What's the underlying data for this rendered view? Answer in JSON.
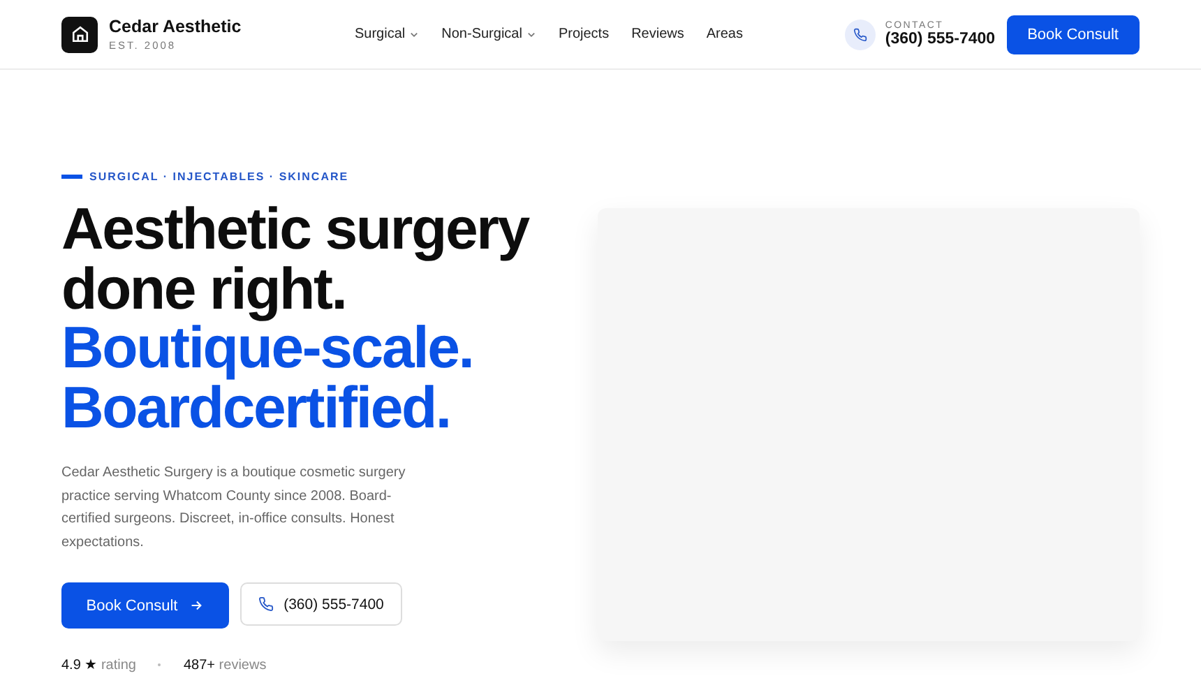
{
  "brand": {
    "name": "Cedar Aesthetic",
    "tagline": "EST. 2008"
  },
  "nav": [
    {
      "label": "Surgical",
      "dropdown": true
    },
    {
      "label": "Non-Surgical",
      "dropdown": true
    },
    {
      "label": "Projects",
      "dropdown": false
    },
    {
      "label": "Reviews",
      "dropdown": false
    },
    {
      "label": "Areas",
      "dropdown": false
    }
  ],
  "contact": {
    "label": "CONTACT",
    "phone": "(360) 555-7400"
  },
  "header_button": "Book Consult",
  "hero": {
    "eyebrow": "SURGICAL · INJECTABLES · SKINCARE",
    "headline_dark": [
      "Aesthetic surgery",
      "done right."
    ],
    "headline_accent": [
      "Boutique-scale.",
      "Boardcertified."
    ],
    "description": "Cedar Aesthetic Surgery is a boutique cosmetic surgery practice serving Whatcom County since 2008. Board-certified surgeons. Discreet, in-office consults. Honest expectations.",
    "primary_button": "Book Consult",
    "phone_button": "(360) 555-7400",
    "stats": [
      {
        "value": "4.9 ★",
        "label": "rating"
      },
      {
        "value": "487+",
        "label": "reviews"
      }
    ]
  }
}
